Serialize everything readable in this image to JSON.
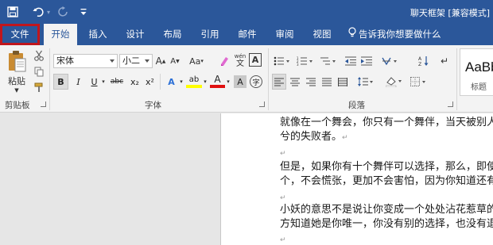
{
  "titlebar": {
    "doc_title": "聊天框架 [兼容模式]",
    "quick_access": [
      {
        "name": "save-icon",
        "glyph": "🖫"
      },
      {
        "name": "undo-icon",
        "glyph": "↶"
      },
      {
        "name": "undo-dropdown-icon",
        "glyph": "▾"
      },
      {
        "name": "redo-icon",
        "glyph": "↻"
      },
      {
        "name": "customize-qa-icon",
        "glyph": "⇣"
      }
    ]
  },
  "tabs": {
    "file": "文件",
    "home": "开始",
    "insert": "插入",
    "design": "设计",
    "layout": "布局",
    "references": "引用",
    "mailings": "邮件",
    "review": "审阅",
    "view": "视图",
    "tell_me": "告诉我你想要做什么"
  },
  "ribbon": {
    "clipboard": {
      "label": "剪贴板",
      "paste": "粘贴"
    },
    "font": {
      "label": "字体",
      "font_name": "宋体",
      "font_size": "小二",
      "grow": "A",
      "shrink": "A",
      "change_case": "Aa",
      "clear": "A",
      "phonetic": "wén",
      "border": "A",
      "bold": "B",
      "italic": "I",
      "underline": "U",
      "strike": "abc",
      "subscript": "x₂",
      "superscript": "x²",
      "effects": "A",
      "highlight": "ab",
      "font_color": "A",
      "shade": "A",
      "enclose": "字"
    },
    "paragraph": {
      "label": "段落"
    },
    "styles": {
      "sample": "AaBbC",
      "name": "标题"
    }
  },
  "document": {
    "lines": [
      "就像在一个舞会，你只有一个舞伴，当天被别人抢走，你就成为舞会上唯一",
      "兮的失败者。",
      "但是，如果你有十个舞伴可以选择，那么，即使被别人抢走了一",
      "个，不会慌张，更加不会害怕，因为你知道还有其他人可以选择。",
      "小妖的意思不是说让你变成一个处处沾花惹草的人，而是说，",
      "方知道她是你唯一，你没有别的选择，也没有退路。"
    ],
    "paragraph_mark": "↵"
  }
}
